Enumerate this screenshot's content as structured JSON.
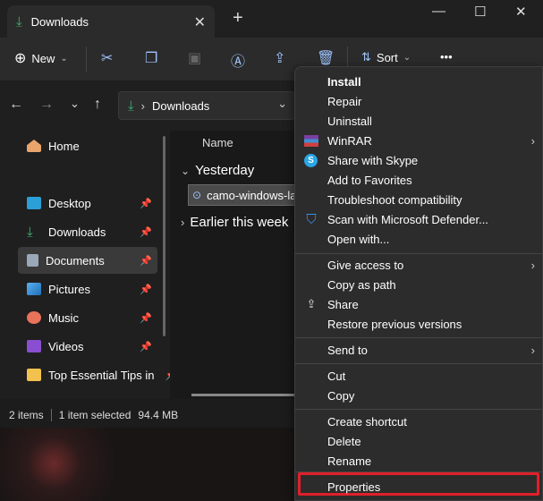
{
  "window": {
    "tab_title": "Downloads",
    "tab_close_glyph": "✕",
    "new_tab_glyph": "+",
    "minimize_glyph": "—",
    "maximize_glyph": "☐",
    "close_glyph": "✕"
  },
  "toolbar": {
    "new_label": "New",
    "sort_label": "Sort",
    "more_glyph": "•••"
  },
  "address": {
    "back_glyph": "←",
    "forward_glyph": "→",
    "dropdown_glyph": "⌄",
    "up_glyph": "↑",
    "separator": "›",
    "path": "Downloads",
    "expand_glyph": "⌄"
  },
  "sidebar": {
    "items": [
      {
        "label": "Home",
        "pinned": false
      },
      {
        "label": "Desktop",
        "pinned": true
      },
      {
        "label": "Downloads",
        "pinned": true
      },
      {
        "label": "Documents",
        "pinned": true
      },
      {
        "label": "Pictures",
        "pinned": true
      },
      {
        "label": "Music",
        "pinned": true
      },
      {
        "label": "Videos",
        "pinned": true
      },
      {
        "label": "Top Essential Tips in",
        "pinned": true
      }
    ],
    "pin_glyph": "📌"
  },
  "files": {
    "column_name": "Name",
    "group_yesterday": "Yesterday",
    "group_earlier": "Earlier this week",
    "file_name": "camo-windows-la"
  },
  "status": {
    "items": "2 items",
    "selected": "1 item selected",
    "size": "94.4 MB"
  },
  "context_menu": {
    "install": "Install",
    "repair": "Repair",
    "uninstall": "Uninstall",
    "winrar": "WinRAR",
    "share_skype": "Share with Skype",
    "add_favorites": "Add to Favorites",
    "troubleshoot": "Troubleshoot compatibility",
    "scan_defender": "Scan with Microsoft Defender...",
    "open_with": "Open with...",
    "give_access": "Give access to",
    "copy_path": "Copy as path",
    "share": "Share",
    "restore_versions": "Restore previous versions",
    "send_to": "Send to",
    "cut": "Cut",
    "copy": "Copy",
    "create_shortcut": "Create shortcut",
    "delete": "Delete",
    "rename": "Rename",
    "properties": "Properties",
    "submenu_arrow": "›"
  },
  "colors": {
    "accent_green": "#3cb371",
    "highlight_red": "#e0202a"
  }
}
